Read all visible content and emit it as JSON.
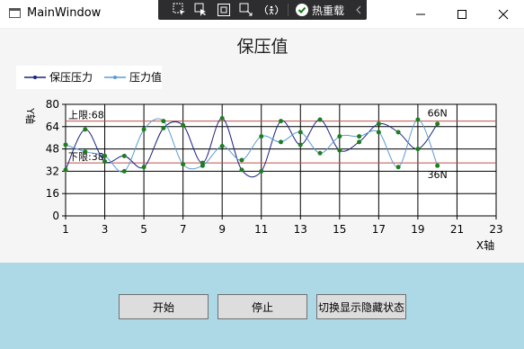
{
  "window": {
    "title": "MainWindow"
  },
  "devtools": {
    "hot_reload_label": "热重载"
  },
  "chart_data": {
    "type": "line",
    "title": "保压值",
    "xlabel": "X轴",
    "ylabel": "Y轴",
    "xlim": [
      1,
      23
    ],
    "ylim": [
      0,
      80
    ],
    "x_ticks": [
      "1",
      "3",
      "5",
      "7",
      "9",
      "11",
      "13",
      "15",
      "17",
      "19",
      "21",
      "23"
    ],
    "y_ticks": [
      "0",
      "16",
      "32",
      "48",
      "64",
      "80"
    ],
    "grid": true,
    "legend": "top-left",
    "series": [
      {
        "name": "保压压力",
        "color": "#1a237e",
        "x": [
          1,
          2,
          3,
          4,
          5,
          6,
          7,
          8,
          9,
          10,
          11,
          12,
          13,
          14,
          15,
          16,
          17,
          18,
          19,
          20
        ],
        "values": [
          33,
          62,
          39,
          43,
          35,
          63,
          65,
          38,
          70,
          33,
          32,
          68,
          51,
          69,
          47,
          53,
          66,
          60,
          48,
          66
        ]
      },
      {
        "name": "压力值",
        "color": "#5b9bd5",
        "x": [
          1,
          2,
          3,
          4,
          5,
          6,
          7,
          8,
          9,
          10,
          11,
          12,
          13,
          14,
          15,
          16,
          17,
          18,
          19,
          20
        ],
        "values": [
          51,
          46,
          43,
          32,
          62,
          68,
          37,
          36,
          50,
          40,
          57,
          53,
          60,
          45,
          57,
          57,
          60,
          35,
          69,
          36
        ]
      }
    ],
    "reference_lines": [
      {
        "label": "上限:68",
        "value": 68,
        "color": "#c0504d"
      },
      {
        "label": "下限:38",
        "value": 38,
        "color": "#c0504d"
      }
    ],
    "annotations": [
      {
        "text": "66N",
        "x": 20,
        "y": 66
      },
      {
        "text": "36N",
        "x": 20,
        "y": 36
      }
    ]
  },
  "buttons": {
    "start": "开始",
    "stop": "停止",
    "toggle": "切换显示隐藏状态"
  }
}
